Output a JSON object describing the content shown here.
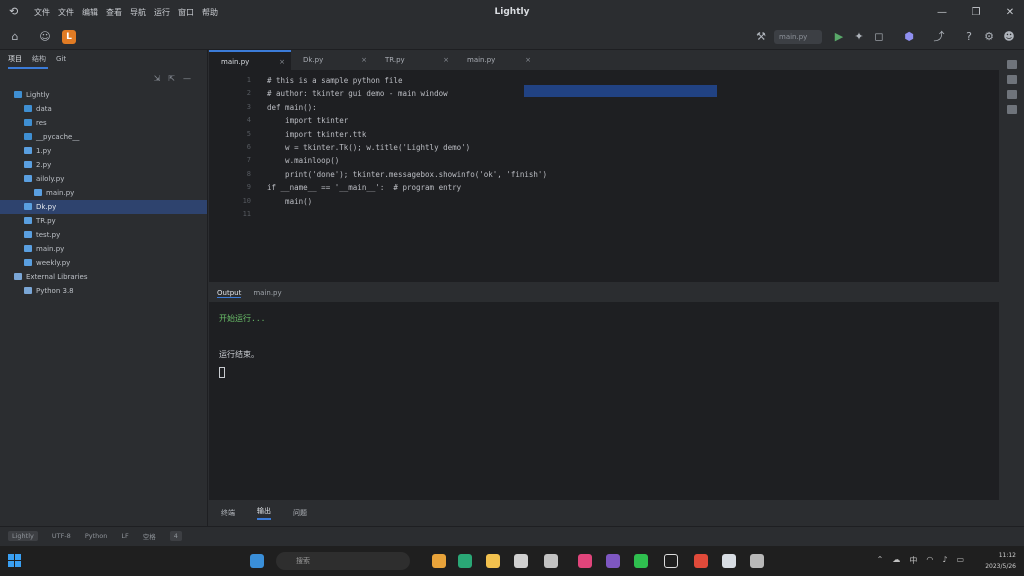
{
  "window": {
    "title": "Lightly",
    "menu": [
      "文件",
      "文件",
      "编辑",
      "查看",
      "导航",
      "运行",
      "窗口",
      "帮助"
    ],
    "controls": [
      "—",
      "❐",
      "✕"
    ]
  },
  "toolbar": {
    "run_config": "main.py"
  },
  "project_panel": {
    "tabs": [
      "项目",
      "结构",
      "Git"
    ],
    "tree": [
      {
        "label": "Lightly",
        "icon": "folder",
        "indent": 0
      },
      {
        "label": "data",
        "icon": "folder",
        "indent": 1
      },
      {
        "label": "res",
        "icon": "folder",
        "indent": 1
      },
      {
        "label": "__pycache__",
        "icon": "folder",
        "indent": 1
      },
      {
        "label": "1.py",
        "icon": "py",
        "indent": 1
      },
      {
        "label": "2.py",
        "icon": "py",
        "indent": 1
      },
      {
        "label": "ailoly.py",
        "icon": "py",
        "indent": 1
      },
      {
        "label": "main.py",
        "icon": "py",
        "indent": 2
      },
      {
        "label": "Dk.py",
        "icon": "py",
        "indent": 1,
        "selected": true
      },
      {
        "label": "TR.py",
        "icon": "py",
        "indent": 1
      },
      {
        "label": "test.py",
        "icon": "py",
        "indent": 1
      },
      {
        "label": "main.py",
        "icon": "py",
        "indent": 1
      },
      {
        "label": "weekly.py",
        "icon": "py",
        "indent": 1
      },
      {
        "label": "External Libraries",
        "icon": "lib",
        "indent": 0
      },
      {
        "label": "Python 3.8",
        "icon": "lib",
        "indent": 1
      }
    ]
  },
  "editor": {
    "tabs": [
      {
        "label": "main.py",
        "active": true
      },
      {
        "label": "Dk.py",
        "active": false
      },
      {
        "label": "TR.py",
        "active": false
      },
      {
        "label": "main.py",
        "active": false
      }
    ],
    "line_numbers": [
      "1",
      "2",
      "3",
      "4",
      "5",
      "6",
      "7",
      "8",
      "9",
      "10",
      "11"
    ],
    "lines": [
      {
        "type": "comment",
        "text": "# this is a sample python file"
      },
      {
        "type": "comment",
        "text": "# author: tkinter gui demo - main window"
      },
      {
        "type": "code",
        "text": "def main():"
      },
      {
        "type": "code",
        "text": "    import tkinter"
      },
      {
        "type": "code",
        "text": "    import tkinter.ttk"
      },
      {
        "type": "dim",
        "text": "    w = tkinter.Tk(); w.title('Lightly demo')"
      },
      {
        "type": "dim",
        "text": "    w.mainloop()"
      },
      {
        "type": "dim",
        "text": "    print('done'); tkinter.messagebox.showinfo('ok', 'finish')"
      },
      {
        "type": "code",
        "text": "if __name__ == '__main__':  # program entry"
      },
      {
        "type": "code",
        "text": "    main()"
      },
      {
        "type": "code",
        "text": ""
      }
    ]
  },
  "output": {
    "tabs": [
      "Output",
      "main.py"
    ],
    "lines": [
      "开始运行...",
      "",
      "运行结束。"
    ]
  },
  "bottom_tabs": [
    "终端",
    "输出",
    "问题"
  ],
  "status": {
    "items": [
      "Lightly",
      "UTF-8",
      "Python",
      "LF",
      "空格",
      "4"
    ]
  },
  "taskbar": {
    "search_placeholder": "搜索",
    "clock_time": "11:12",
    "clock_date": "2023/5/26"
  }
}
